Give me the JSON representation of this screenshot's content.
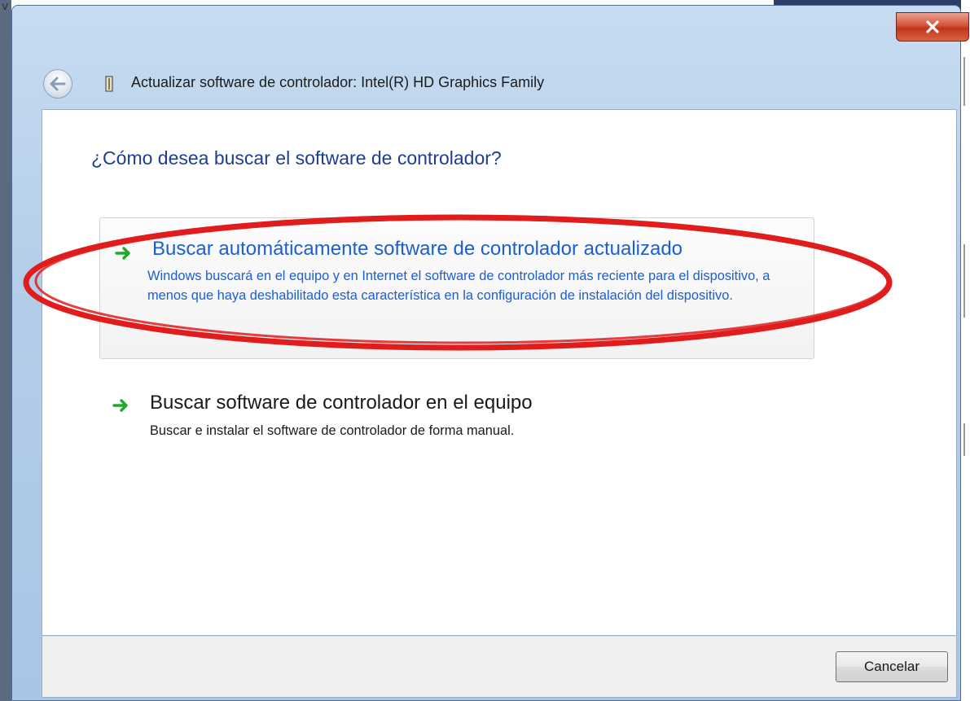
{
  "window": {
    "title": "Actualizar software de controlador: Intel(R) HD Graphics Family",
    "close_icon": "close-icon",
    "back_icon": "back-arrow-icon",
    "device_icon": "graphics-card-icon"
  },
  "main": {
    "question": "¿Cómo desea buscar el software de controlador?",
    "options": [
      {
        "title": "Buscar automáticamente software de controlador actualizado",
        "description": "Windows buscará en el equipo y en Internet el software de controlador más reciente para el dispositivo, a menos que haya deshabilitado esta característica en la configuración de instalación del dispositivo.",
        "icon": "green-arrow-icon",
        "highlighted": true
      },
      {
        "title": "Buscar software de controlador en el equipo",
        "description": "Buscar e instalar el software de controlador de forma manual.",
        "icon": "green-arrow-icon",
        "highlighted": false
      }
    ],
    "annotation_color": "#e01c1c"
  },
  "footer": {
    "cancel_label": "Cancelar"
  },
  "background": {
    "corner_text": "v"
  },
  "colors": {
    "link_blue": "#1a5fd6",
    "heading_blue": "#1e3d92",
    "arrow_green": "#1faa2c",
    "close_red": "#c0361c"
  }
}
